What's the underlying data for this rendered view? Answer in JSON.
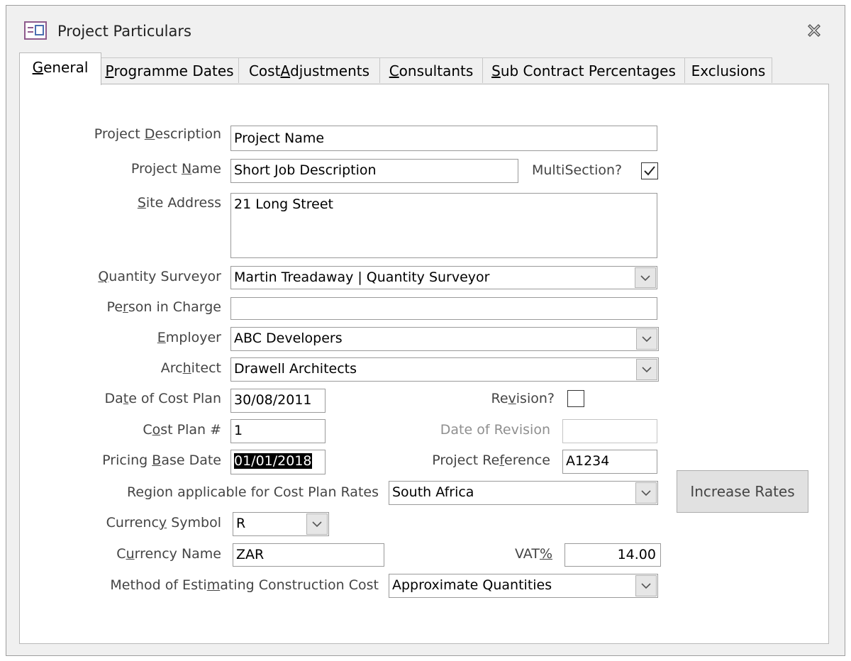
{
  "window": {
    "title": "Project Particulars"
  },
  "icons": {
    "form_icon": "form-icon",
    "close_icon": "close-icon",
    "dropdown_icon": "chevron-down-icon",
    "check_icon": "checkmark-icon"
  },
  "tabs": [
    {
      "pre": "",
      "key": "G",
      "post": "eneral",
      "active": true
    },
    {
      "pre": "",
      "key": "P",
      "post": "rogramme Dates",
      "active": false
    },
    {
      "pre": "Cost ",
      "key": "A",
      "post": "djustments",
      "active": false
    },
    {
      "pre": "",
      "key": "C",
      "post": "onsultants",
      "active": false
    },
    {
      "pre": "",
      "key": "S",
      "post": "ub Contract Percentages",
      "active": false
    },
    {
      "pre": "",
      "key": "",
      "post": "Exclusions",
      "active": false
    }
  ],
  "labels": {
    "project_description": {
      "pre": "Project ",
      "key": "D",
      "post": "escription"
    },
    "project_name": {
      "pre": "Project ",
      "key": "N",
      "post": "ame"
    },
    "multisection": {
      "pre": "MultiSection?",
      "key": "",
      "post": ""
    },
    "site_address": {
      "pre": "",
      "key": "S",
      "post": "ite Address"
    },
    "quantity_surveyor": {
      "pre": "",
      "key": "Q",
      "post": "uantity Surveyor"
    },
    "person_in_charge": {
      "pre": "Pe",
      "key": "r",
      "post": "son in Charge"
    },
    "employer": {
      "pre": "",
      "key": "E",
      "post": "mployer"
    },
    "architect": {
      "pre": "Arc",
      "key": "h",
      "post": "itect"
    },
    "date_of_cost_plan": {
      "pre": "Da",
      "key": "t",
      "post": "e of Cost Plan"
    },
    "revision": {
      "pre": "Re",
      "key": "v",
      "post": "ision?"
    },
    "cost_plan_no": {
      "pre": "C",
      "key": "o",
      "post": "st Plan #"
    },
    "date_of_revision": {
      "pre": "Date of Revision",
      "key": "",
      "post": ""
    },
    "pricing_base_date": {
      "pre": "Pricing ",
      "key": "B",
      "post": "ase Date"
    },
    "project_reference": {
      "pre": "Project Re",
      "key": "f",
      "post": "erence"
    },
    "region": {
      "pre": "Re",
      "key": "g",
      "post": "ion applicable for Cost Plan Rates"
    },
    "currency_symbol": {
      "pre": "Currenc",
      "key": "y",
      "post": " Symbol"
    },
    "currency_name": {
      "pre": "C",
      "key": "u",
      "post": "rrency Name"
    },
    "vat": {
      "pre": "VAT",
      "key": "%",
      "post": ""
    },
    "method": {
      "pre": "Method of Esti",
      "key": "m",
      "post": "ating Construction Cost"
    }
  },
  "values": {
    "project_description": "Project Name",
    "project_name": "Short Job Description",
    "multisection_checked": true,
    "site_address": "21 Long Street",
    "quantity_surveyor": "Martin Treadaway | Quantity Surveyor",
    "person_in_charge": "",
    "employer": "ABC Developers",
    "architect": "Drawell Architects",
    "date_of_cost_plan": "30/08/2011",
    "revision_checked": false,
    "cost_plan_no": "1",
    "date_of_revision": "",
    "pricing_base_date": "01/01/2018",
    "project_reference": "A1234",
    "region": "South Africa",
    "currency_symbol": "R",
    "currency_name": "ZAR",
    "vat": "14.00",
    "method": "Approximate Quantities"
  },
  "buttons": {
    "increase_rates": "Increase Rates"
  },
  "colors": {
    "window_bg": "#f0f0f0",
    "content_bg": "#ffffff",
    "label_text": "#444444",
    "disabled_label": "#8f8f8f",
    "selection_bg": "#000000"
  }
}
